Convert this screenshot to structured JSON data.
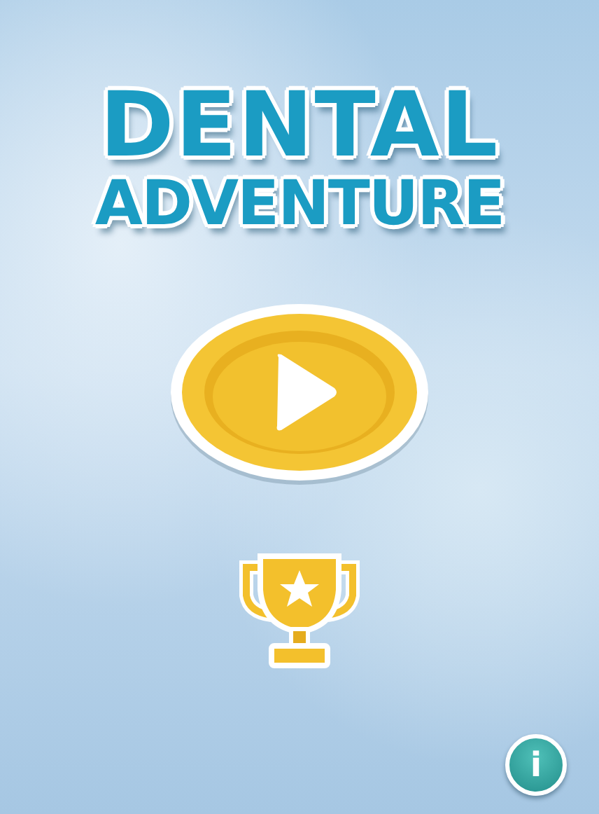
{
  "title": {
    "line_1": "DENTAL",
    "line_2": "ADVENTURE"
  },
  "info_button": {
    "label": "i"
  }
}
